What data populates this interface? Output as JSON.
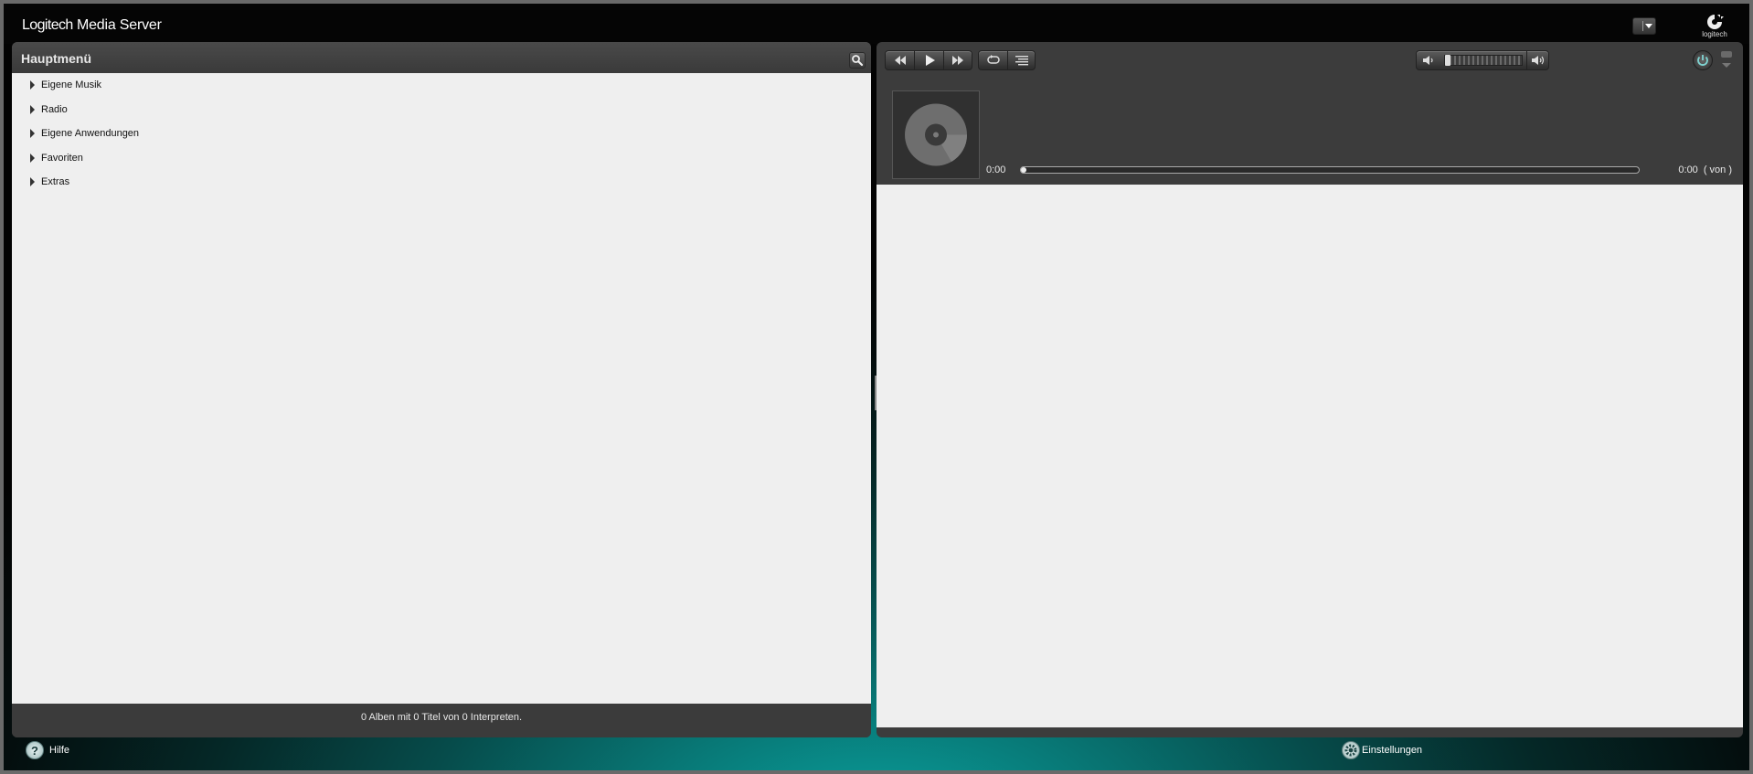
{
  "header": {
    "brand": "Logitech",
    "title": "Media Server",
    "logo_text": "logitech"
  },
  "browser": {
    "title": "Hauptmenü",
    "search_icon": "search-icon",
    "items": [
      {
        "label": "Eigene Musik"
      },
      {
        "label": "Radio"
      },
      {
        "label": "Eigene Anwendungen"
      },
      {
        "label": "Favoriten"
      },
      {
        "label": "Extras"
      }
    ],
    "footer": "0 Alben mit 0 Titel von 0 Interpreten."
  },
  "player": {
    "elapsed": "0:00",
    "remaining": "0:00",
    "of_text": "( von )",
    "progress": 0,
    "volume": 0,
    "controls": [
      "rewind-icon",
      "play-icon",
      "fast-forward-icon",
      "repeat-icon",
      "playlist-icon"
    ]
  },
  "footer": {
    "help_label": "Hilfe",
    "help_icon": "?",
    "settings_label": "Einstellungen"
  },
  "colors": {
    "accent": "#0aa3a0",
    "panel": "#3c3c3c",
    "content_bg": "#efefef"
  }
}
